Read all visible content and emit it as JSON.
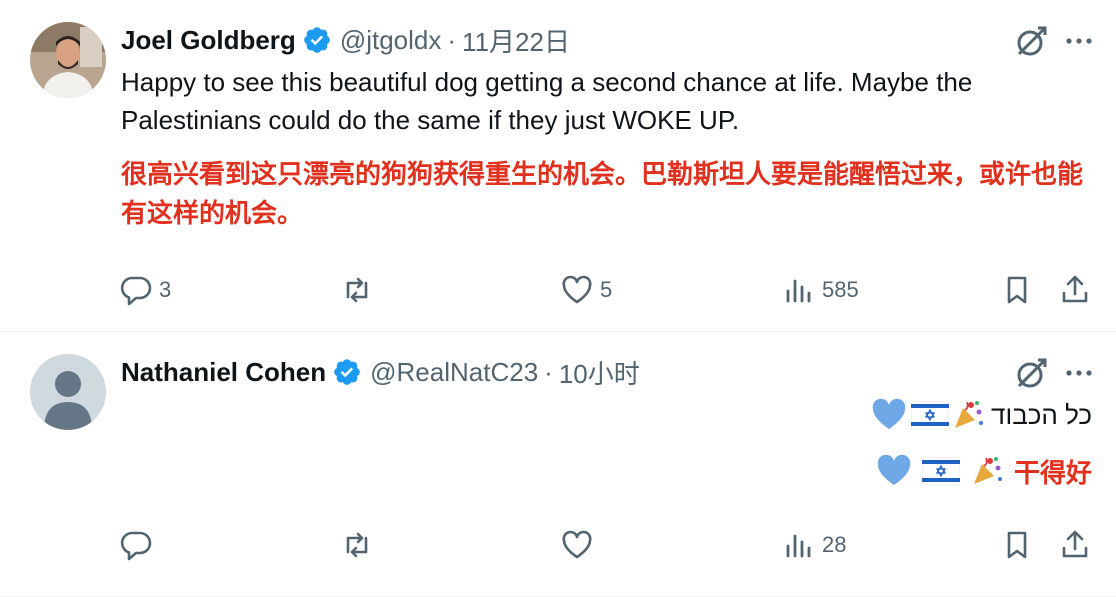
{
  "colors": {
    "verified": "#1d9bf0",
    "muted": "#536471",
    "text": "#0f1419",
    "translation": "#e0301e",
    "heart_emoji": "#6fa8e6",
    "flag_blue": "#1f62c4"
  },
  "tweets": [
    {
      "author": {
        "name": "Joel Goldberg",
        "handle": "@jtgoldx",
        "verified": true
      },
      "separator": "·",
      "time": "11月22日",
      "text": "Happy to see this beautiful dog getting a second chance at life. Maybe the Palestinians could do the same if they just WOKE UP.",
      "translation": "很高兴看到这只漂亮的狗狗获得重生的机会。巴勒斯坦人要是能醒悟过来，或许也能有这样的机会。",
      "actions": {
        "reply": "3",
        "retweet": "",
        "like": "5",
        "views": "585"
      }
    },
    {
      "author": {
        "name": "Nathaniel Cohen",
        "handle": "@RealNatC23",
        "verified": true
      },
      "separator": "·",
      "time": "10小时",
      "text": "כל הכבוד",
      "translation": "干得好",
      "actions": {
        "reply": "",
        "retweet": "",
        "like": "",
        "views": "28"
      }
    }
  ],
  "icons": [
    "grok-icon",
    "more-icon",
    "reply-icon",
    "retweet-icon",
    "like-icon",
    "views-icon",
    "bookmark-icon",
    "share-icon",
    "blue-heart-emoji",
    "israel-flag-emoji",
    "party-popper-emoji"
  ]
}
